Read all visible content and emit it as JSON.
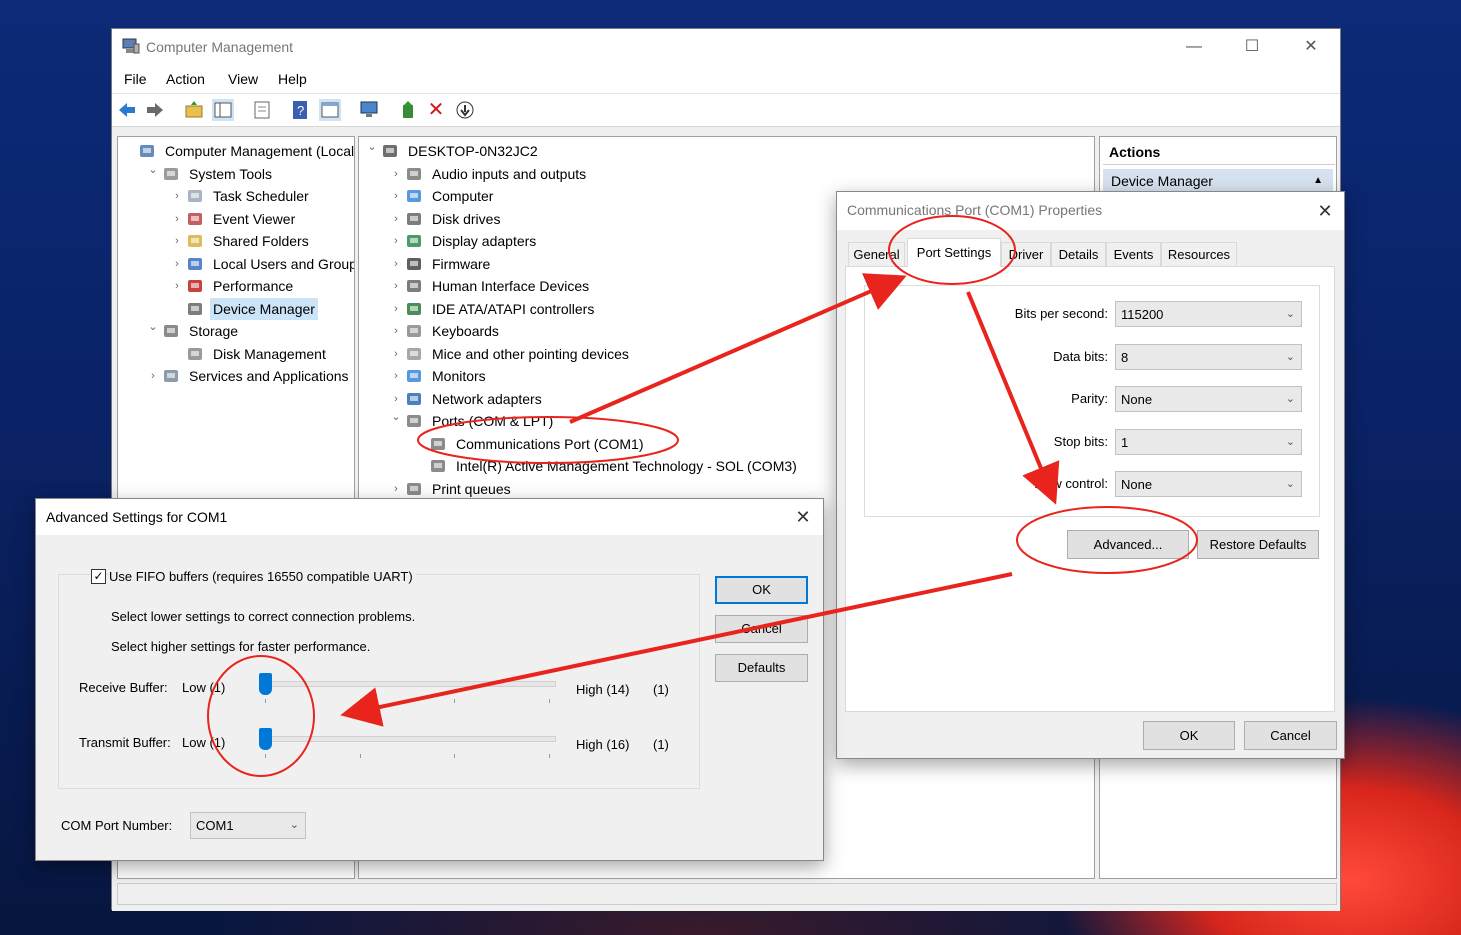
{
  "computer_management": {
    "title": "Computer Management",
    "controls": {
      "minimize": "—",
      "maximize": "☐",
      "close": "✕"
    },
    "menu": [
      "File",
      "Action",
      "View",
      "Help"
    ],
    "toolbar_icons": [
      "back-arrow-icon",
      "forward-arrow-icon",
      "up-folder-icon",
      "show-hide-tree-icon",
      "properties-icon",
      "help-icon",
      "console-view-icon",
      "computer-monitor-icon",
      "update-driver-icon",
      "uninstall-icon",
      "scan-hardware-icon"
    ],
    "left_tree": [
      {
        "label": "Computer Management (Local)",
        "level": 0,
        "chevron": "",
        "icon": "computer-management-icon"
      },
      {
        "label": "System Tools",
        "level": 1,
        "chevron": "v",
        "icon": "system-tools-icon"
      },
      {
        "label": "Task Scheduler",
        "level": 2,
        "chevron": ">",
        "icon": "clock-icon"
      },
      {
        "label": "Event Viewer",
        "level": 2,
        "chevron": ">",
        "icon": "event-viewer-icon"
      },
      {
        "label": "Shared Folders",
        "level": 2,
        "chevron": ">",
        "icon": "shared-folder-icon"
      },
      {
        "label": "Local Users and Groups",
        "level": 2,
        "chevron": ">",
        "icon": "users-icon"
      },
      {
        "label": "Performance",
        "level": 2,
        "chevron": ">",
        "icon": "performance-icon"
      },
      {
        "label": "Device Manager",
        "level": 2,
        "chevron": "",
        "icon": "device-manager-icon",
        "selected": true
      },
      {
        "label": "Storage",
        "level": 1,
        "chevron": "v",
        "icon": "storage-icon"
      },
      {
        "label": "Disk Management",
        "level": 2,
        "chevron": "",
        "icon": "disk-management-icon"
      },
      {
        "label": "Services and Applications",
        "level": 1,
        "chevron": ">",
        "icon": "services-icon"
      }
    ],
    "device_tree": [
      {
        "label": "DESKTOP-0N32JC2",
        "level": 0,
        "chevron": "v",
        "icon": "desktop-computer-icon"
      },
      {
        "label": "Audio inputs and outputs",
        "level": 1,
        "chevron": ">",
        "icon": "speaker-icon"
      },
      {
        "label": "Computer",
        "level": 1,
        "chevron": ">",
        "icon": "monitor-icon"
      },
      {
        "label": "Disk drives",
        "level": 1,
        "chevron": ">",
        "icon": "disk-drive-icon"
      },
      {
        "label": "Display adapters",
        "level": 1,
        "chevron": ">",
        "icon": "display-adapter-icon"
      },
      {
        "label": "Firmware",
        "level": 1,
        "chevron": ">",
        "icon": "firmware-icon"
      },
      {
        "label": "Human Interface Devices",
        "level": 1,
        "chevron": ">",
        "icon": "hid-icon"
      },
      {
        "label": "IDE ATA/ATAPI controllers",
        "level": 1,
        "chevron": ">",
        "icon": "ide-controller-icon"
      },
      {
        "label": "Keyboards",
        "level": 1,
        "chevron": ">",
        "icon": "keyboard-icon"
      },
      {
        "label": "Mice and other pointing devices",
        "level": 1,
        "chevron": ">",
        "icon": "mouse-icon"
      },
      {
        "label": "Monitors",
        "level": 1,
        "chevron": ">",
        "icon": "monitor-icon"
      },
      {
        "label": "Network adapters",
        "level": 1,
        "chevron": ">",
        "icon": "network-adapter-icon"
      },
      {
        "label": "Ports (COM & LPT)",
        "level": 1,
        "chevron": "v",
        "icon": "port-icon"
      },
      {
        "label": "Communications Port (COM1)",
        "level": 2,
        "chevron": "",
        "icon": "port-icon"
      },
      {
        "label": "Intel(R) Active Management Technology - SOL (COM3)",
        "level": 2,
        "chevron": "",
        "icon": "port-icon"
      },
      {
        "label": "Print queues",
        "level": 1,
        "chevron": ">",
        "icon": "printer-icon"
      }
    ],
    "actions": {
      "header": "Actions",
      "device_manager": "Device Manager",
      "expand_arrow": "▲"
    }
  },
  "properties_dialog": {
    "title": "Communications Port (COM1) Properties",
    "tabs": [
      "General",
      "Port Settings",
      "Driver",
      "Details",
      "Events",
      "Resources"
    ],
    "active_tab": "Port Settings",
    "fields": [
      {
        "label": "Bits per second:",
        "value": "115200"
      },
      {
        "label": "Data bits:",
        "value": "8"
      },
      {
        "label": "Parity:",
        "value": "None"
      },
      {
        "label": "Stop bits:",
        "value": "1"
      },
      {
        "label": "Flow control:",
        "value": "None"
      }
    ],
    "advanced_button": "Advanced...",
    "restore_button": "Restore Defaults",
    "ok_button": "OK",
    "cancel_button": "Cancel"
  },
  "advanced_dialog": {
    "title": "Advanced Settings for COM1",
    "fifo_checkbox": {
      "label": "Use FIFO buffers (requires 16550 compatible UART)",
      "checked": true
    },
    "hint_lower": "Select lower settings to correct connection problems.",
    "hint_higher": "Select higher settings for faster performance.",
    "receive": {
      "label": "Receive Buffer:",
      "low": "Low (1)",
      "high": "High (14)",
      "current": "(1)",
      "level": 0
    },
    "transmit": {
      "label": "Transmit Buffer:",
      "low": "Low (1)",
      "high": "High (16)",
      "current": "(1)",
      "level": 0
    },
    "com_port": {
      "label": "COM Port Number:",
      "value": "COM1"
    },
    "ok_button": "OK",
    "cancel_button": "Cancel",
    "defaults_button": "Defaults"
  },
  "annotation_color": "#e8241c"
}
